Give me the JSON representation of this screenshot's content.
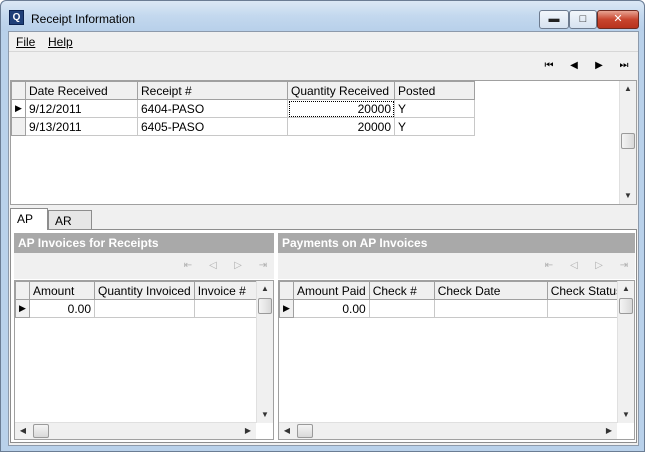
{
  "window": {
    "title": "Receipt Information",
    "icon": "app-q-icon",
    "controls": {
      "minimize": "minimize-icon",
      "maximize": "maximize-icon",
      "close": "close-icon"
    }
  },
  "menu": {
    "file": "File",
    "help": "Help"
  },
  "navigation": {
    "first": "⏮",
    "prev": "◀",
    "next": "▶",
    "last": "⏭"
  },
  "receipts": {
    "columns": [
      "Date Received",
      "Receipt #",
      "Quantity Received",
      "Posted"
    ],
    "rows": [
      {
        "date": "9/12/2011",
        "receipt": "6404-PASO",
        "qty": "20000",
        "posted": "Y"
      },
      {
        "date": "9/13/2011",
        "receipt": "6405-PASO",
        "qty": "20000",
        "posted": "Y"
      }
    ]
  },
  "tabs": {
    "ap": "AP",
    "ar": "AR"
  },
  "ap_invoices": {
    "header": "AP Invoices for Receipts",
    "columns": [
      "Amount",
      "Quantity Invoiced",
      "Invoice #"
    ],
    "rows": [
      {
        "amount": "0.00"
      }
    ]
  },
  "payments": {
    "header": "Payments on AP Invoices",
    "columns": [
      "Amount Paid",
      "Check #",
      "Check Date",
      "Check Status"
    ],
    "rows": [
      {
        "amount_paid": "0.00"
      }
    ]
  },
  "colors": {
    "selection": "#3399ff",
    "pane_header": "#a9a9a9",
    "title_bar": "#c3d8ee"
  }
}
